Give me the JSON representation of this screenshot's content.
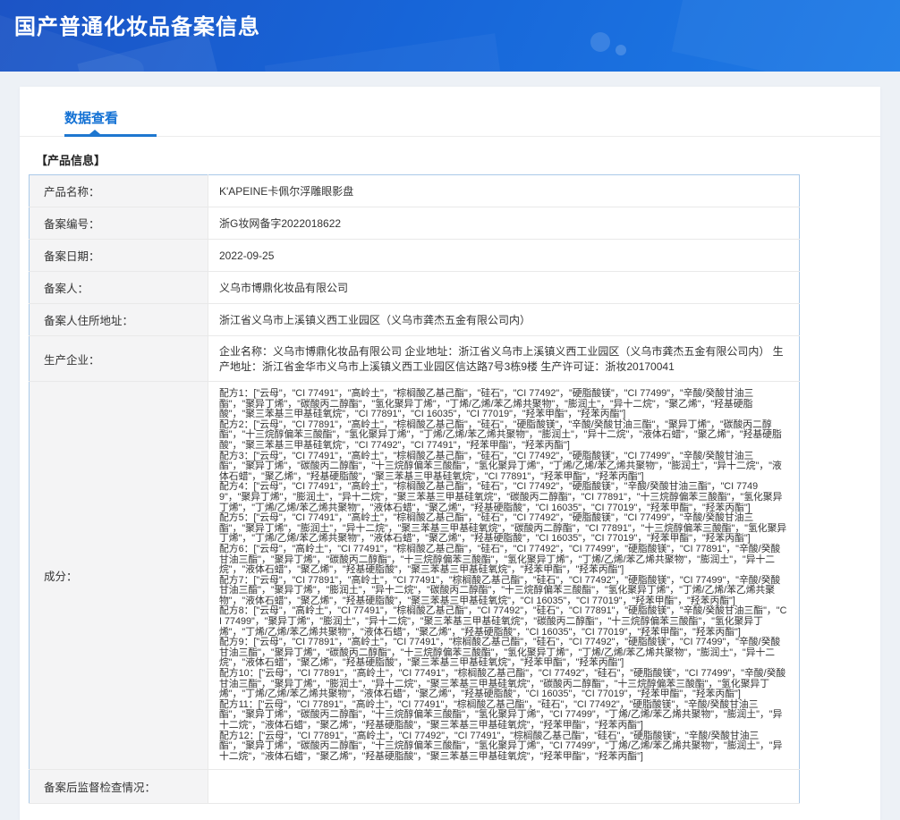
{
  "banner": {
    "title": "国产普通化妆品备案信息"
  },
  "tabs": [
    {
      "label": "数据查看",
      "active": true
    }
  ],
  "section_title": "【产品信息】",
  "product_info": {
    "rows": [
      {
        "label": "产品名称：",
        "value": "K'APEINE卡佩尔浮雕眼影盘"
      },
      {
        "label": "备案编号：",
        "value": "浙G妆网备字2022018622"
      },
      {
        "label": "备案日期：",
        "value": "2022-09-25"
      },
      {
        "label": "备案人：",
        "value": "义乌市博鼎化妆品有限公司"
      },
      {
        "label": "备案人住所地址：",
        "value": "浙江省义乌市上溪镇义西工业园区（义乌市龚杰五金有限公司内）"
      },
      {
        "label": "生产企业：",
        "value": "企业名称：义乌市博鼎化妆品有限公司 企业地址：浙江省义乌市上溪镇义西工业园区（义乌市龚杰五金有限公司内） 生产地址：浙江省金华市义乌市上溪镇义西工业园区信达路7号3栋9楼 生产许可证：浙妆20170041"
      }
    ]
  },
  "ingredients": {
    "label": "成分：",
    "open_bracket": "：[\"",
    "item_separator": "\"，\"",
    "close_bracket": "\"]",
    "formulas": [
      {
        "name": "配方1",
        "items": [
          "云母",
          "CI 77491",
          "高岭土",
          "棕榈酸乙基己酯",
          "硅石",
          "CI 77492",
          "硬脂酸镁",
          "CI 77499",
          "辛酸/癸酸甘油三酯",
          "聚异丁烯",
          "碳酸丙二醇酯",
          "氢化聚异丁烯",
          "丁烯/乙烯/苯乙烯共聚物",
          "膨润土",
          "异十二烷",
          "聚乙烯",
          "羟基硬脂酸",
          "聚三苯基三甲基硅氧烷",
          "CI 77891",
          "CI 16035",
          "CI 77019",
          "羟苯甲酯",
          "羟苯丙酯"
        ]
      },
      {
        "name": "配方2",
        "items": [
          "云母",
          "CI 77891",
          "高岭土",
          "棕榈酸乙基己酯",
          "硅石",
          "硬脂酸镁",
          "辛酸/癸酸甘油三酯",
          "聚异丁烯",
          "碳酸丙二醇酯",
          "十三烷醇偏苯三酸酯",
          "氢化聚异丁烯",
          "丁烯/乙烯/苯乙烯共聚物",
          "膨润土",
          "异十二烷",
          "液体石蜡",
          "聚乙烯",
          "羟基硬脂酸",
          "聚三苯基三甲基硅氧烷",
          "CI 77492",
          "CI 77491",
          "羟苯甲酯",
          "羟苯丙酯"
        ]
      },
      {
        "name": "配方3",
        "items": [
          "云母",
          "CI 77491",
          "高岭土",
          "棕榈酸乙基己酯",
          "硅石",
          "CI 77492",
          "硬脂酸镁",
          "CI 77499",
          "辛酸/癸酸甘油三酯",
          "聚异丁烯",
          "碳酸丙二醇酯",
          "十三烷醇偏苯三酸酯",
          "氢化聚异丁烯",
          "丁烯/乙烯/苯乙烯共聚物",
          "膨润土",
          "异十二烷",
          "液体石蜡",
          "聚乙烯",
          "羟基硬脂酸",
          "聚三苯基三甲基硅氧烷",
          "CI 77891",
          "羟苯甲酯",
          "羟苯丙酯"
        ]
      },
      {
        "name": "配方4",
        "items": [
          "云母",
          "CI 77491",
          "高岭土",
          "棕榈酸乙基己酯",
          "硅石",
          "CI 77492",
          "硬脂酸镁",
          "辛酸/癸酸甘油三酯",
          "CI 77499",
          "聚异丁烯",
          "膨润土",
          "异十二烷",
          "聚三苯基三甲基硅氧烷",
          "碳酸丙二醇酯",
          "CI 77891",
          "十三烷醇偏苯三酸酯",
          "氢化聚异丁烯",
          "丁烯/乙烯/苯乙烯共聚物",
          "液体石蜡",
          "聚乙烯",
          "羟基硬脂酸",
          "CI 16035",
          "CI 77019",
          "羟苯甲酯",
          "羟苯丙酯"
        ]
      },
      {
        "name": "配方5",
        "items": [
          "云母",
          "CI 77491",
          "高岭土",
          "棕榈酸乙基己酯",
          "硅石",
          "CI 77492",
          "硬脂酸镁",
          "CI 77499",
          "辛酸/癸酸甘油三酯",
          "聚异丁烯",
          "膨润土",
          "异十二烷",
          "聚三苯基三甲基硅氧烷",
          "碳酸丙二醇酯",
          "CI 77891",
          "十三烷醇偏苯三酸酯",
          "氢化聚异丁烯",
          "丁烯/乙烯/苯乙烯共聚物",
          "液体石蜡",
          "聚乙烯",
          "羟基硬脂酸",
          "CI 16035",
          "CI 77019",
          "羟苯甲酯",
          "羟苯丙酯"
        ]
      },
      {
        "name": "配方6",
        "items": [
          "云母",
          "高岭土",
          "CI 77491",
          "棕榈酸乙基己酯",
          "硅石",
          "CI 77492",
          "CI 77499",
          "硬脂酸镁",
          "CI 77891",
          "辛酸/癸酸甘油三酯",
          "聚异丁烯",
          "碳酸丙二醇酯",
          "十三烷醇偏苯三酸酯",
          "氢化聚异丁烯",
          "丁烯/乙烯/苯乙烯共聚物",
          "膨润土",
          "异十二烷",
          "液体石蜡",
          "聚乙烯",
          "羟基硬脂酸",
          "聚三苯基三甲基硅氧烷",
          "羟苯甲酯",
          "羟苯丙酯"
        ]
      },
      {
        "name": "配方7",
        "items": [
          "云母",
          "CI 77891",
          "高岭土",
          "CI 77491",
          "棕榈酸乙基己酯",
          "硅石",
          "CI 77492",
          "硬脂酸镁",
          "CI 77499",
          "辛酸/癸酸甘油三酯",
          "聚异丁烯",
          "膨润土",
          "异十二烷",
          "碳酸丙二醇酯",
          "十三烷醇偏苯三酸酯",
          "氢化聚异丁烯",
          "丁烯/乙烯/苯乙烯共聚物",
          "液体石蜡",
          "聚乙烯",
          "羟基硬脂酸",
          "聚三苯基三甲基硅氧烷",
          "CI 16035",
          "CI 77019",
          "羟苯甲酯",
          "羟苯丙酯"
        ]
      },
      {
        "name": "配方8",
        "items": [
          "云母",
          "高岭土",
          "CI 77491",
          "棕榈酸乙基己酯",
          "CI 77492",
          "硅石",
          "CI 77891",
          "硬脂酸镁",
          "辛酸/癸酸甘油三酯",
          "CI 77499",
          "聚异丁烯",
          "膨润土",
          "异十二烷",
          "聚三苯基三甲基硅氧烷",
          "碳酸丙二醇酯",
          "十三烷醇偏苯三酸酯",
          "氢化聚异丁烯",
          "丁烯/乙烯/苯乙烯共聚物",
          "液体石蜡",
          "聚乙烯",
          "羟基硬脂酸",
          "CI 16035",
          "CI 77019",
          "羟苯甲酯",
          "羟苯丙酯"
        ]
      },
      {
        "name": "配方9",
        "items": [
          "云母",
          "CI 77891",
          "高岭土",
          "CI 77491",
          "棕榈酸乙基己酯",
          "硅石",
          "CI 77492",
          "硬脂酸镁",
          "CI 77499",
          "辛酸/癸酸甘油三酯",
          "聚异丁烯",
          "碳酸丙二醇酯",
          "十三烷醇偏苯三酸酯",
          "氢化聚异丁烯",
          "丁烯/乙烯/苯乙烯共聚物",
          "膨润土",
          "异十二烷",
          "液体石蜡",
          "聚乙烯",
          "羟基硬脂酸",
          "聚三苯基三甲基硅氧烷",
          "羟苯甲酯",
          "羟苯丙酯"
        ]
      },
      {
        "name": "配方10",
        "items": [
          "云母",
          "CI 77891",
          "高岭土",
          "CI 77491",
          "棕榈酸乙基己酯",
          "CI 77492",
          "硅石",
          "硬脂酸镁",
          "CI 77499",
          "辛酸/癸酸甘油三酯",
          "聚异丁烯",
          "膨润土",
          "异十二烷",
          "聚三苯基三甲基硅氧烷",
          "碳酸丙二醇酯",
          "十三烷醇偏苯三酸酯",
          "氢化聚异丁烯",
          "丁烯/乙烯/苯乙烯共聚物",
          "液体石蜡",
          "聚乙烯",
          "羟基硬脂酸",
          "CI 16035",
          "CI 77019",
          "羟苯甲酯",
          "羟苯丙酯"
        ]
      },
      {
        "name": "配方11",
        "items": [
          "云母",
          "CI 77891",
          "高岭土",
          "CI 77491",
          "棕榈酸乙基己酯",
          "硅石",
          "CI 77492",
          "硬脂酸镁",
          "辛酸/癸酸甘油三酯",
          "聚异丁烯",
          "碳酸丙二醇酯",
          "十三烷醇偏苯三酸酯",
          "氢化聚异丁烯",
          "CI 77499",
          "丁烯/乙烯/苯乙烯共聚物",
          "膨润土",
          "异十二烷",
          "液体石蜡",
          "聚乙烯",
          "羟基硬脂酸",
          "聚三苯基三甲基硅氧烷",
          "羟苯甲酯",
          "羟苯丙酯"
        ]
      },
      {
        "name": "配方12",
        "items": [
          "云母",
          "CI 77891",
          "高岭土",
          "CI 77492",
          "CI 77491",
          "棕榈酸乙基己酯",
          "硅石",
          "硬脂酸镁",
          "辛酸/癸酸甘油三酯",
          "聚异丁烯",
          "碳酸丙二醇酯",
          "十三烷醇偏苯三酸酯",
          "氢化聚异丁烯",
          "CI 77499",
          "丁烯/乙烯/苯乙烯共聚物",
          "膨润土",
          "异十二烷",
          "液体石蜡",
          "聚乙烯",
          "羟基硬脂酸",
          "聚三苯基三甲基硅氧烷",
          "羟苯甲酯",
          "羟苯丙酯"
        ]
      }
    ]
  },
  "supervision_row": {
    "label": "备案后监督检查情况：",
    "value": ""
  }
}
